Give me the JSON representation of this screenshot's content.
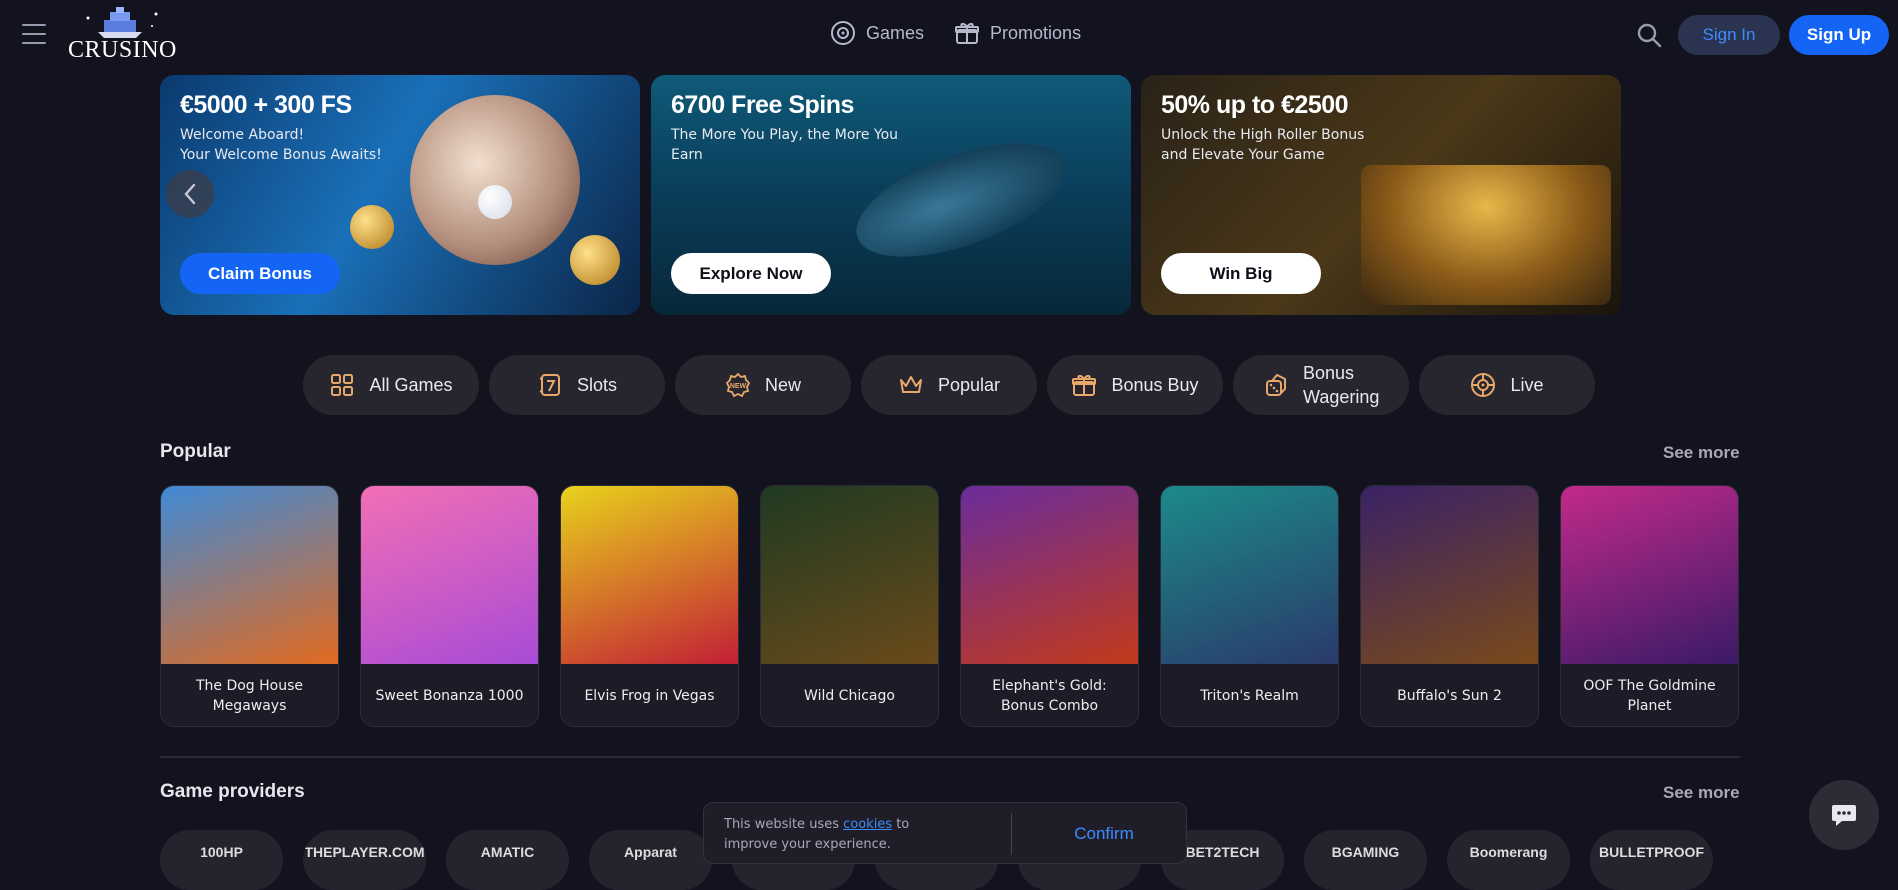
{
  "header": {
    "logo_text": "CRUSINO",
    "nav": [
      {
        "label": "Games",
        "icon": "roulette-icon"
      },
      {
        "label": "Promotions",
        "icon": "gift-icon"
      }
    ],
    "signin_label": "Sign In",
    "signup_label": "Sign Up"
  },
  "banners": [
    {
      "title": "€5000 + 300 FS",
      "subtitle": "Welcome Aboard!\n Your Welcome Bonus Awaits!",
      "button": "Claim Bonus"
    },
    {
      "title": "6700 Free Spins",
      "subtitle": "The More You Play, the More You Earn",
      "button": "Explore Now"
    },
    {
      "title": "50% up to €2500",
      "subtitle": "Unlock the High Roller Bonus and Elevate Your Game",
      "button": "Win Big"
    }
  ],
  "categories": [
    {
      "label": "All Games",
      "icon": "grid-icon"
    },
    {
      "label": "Slots",
      "icon": "slot-seven-icon"
    },
    {
      "label": "New",
      "icon": "new-badge-icon"
    },
    {
      "label": "Popular",
      "icon": "crown-icon"
    },
    {
      "label": "Bonus Buy",
      "icon": "gift-icon"
    },
    {
      "label": "Bonus Wagering",
      "icon": "dice-icon"
    },
    {
      "label": "Live",
      "icon": "roulette-icon"
    }
  ],
  "popular": {
    "title": "Popular",
    "see_more": "See more",
    "games": [
      {
        "name": "The Dog House Megaways",
        "colors": [
          "#3f8ad6",
          "#e26a1f"
        ]
      },
      {
        "name": "Sweet Bonanza 1000",
        "colors": [
          "#f26fb5",
          "#a84bd6"
        ]
      },
      {
        "name": "Elvis Frog in Vegas",
        "colors": [
          "#e8d21c",
          "#c21f35"
        ]
      },
      {
        "name": "Wild Chicago",
        "colors": [
          "#1f3a22",
          "#6a4a1a"
        ]
      },
      {
        "name": "Elephant's Gold: Bonus Combo",
        "colors": [
          "#6a2c9c",
          "#c23a1a"
        ]
      },
      {
        "name": "Triton's Realm",
        "colors": [
          "#1c8a8a",
          "#2a3a6a"
        ]
      },
      {
        "name": "Buffalo's Sun 2",
        "colors": [
          "#3a2266",
          "#7a4a1a"
        ]
      },
      {
        "name": "OOF The Goldmine Planet",
        "colors": [
          "#c22a8a",
          "#3a1a66"
        ]
      }
    ]
  },
  "providers": {
    "title": "Game providers",
    "see_more": "See more",
    "items": [
      "100HP",
      "THEPLAYER.COM",
      "AMATIC",
      "Apparat",
      "",
      "",
      "",
      "BET2TECH",
      "BGAMING",
      "Boomerang",
      "BULLETPROOF"
    ]
  },
  "cookie": {
    "text_before": "This website uses ",
    "link": "cookies",
    "text_after": " to improve your experience.",
    "confirm": "Confirm"
  }
}
